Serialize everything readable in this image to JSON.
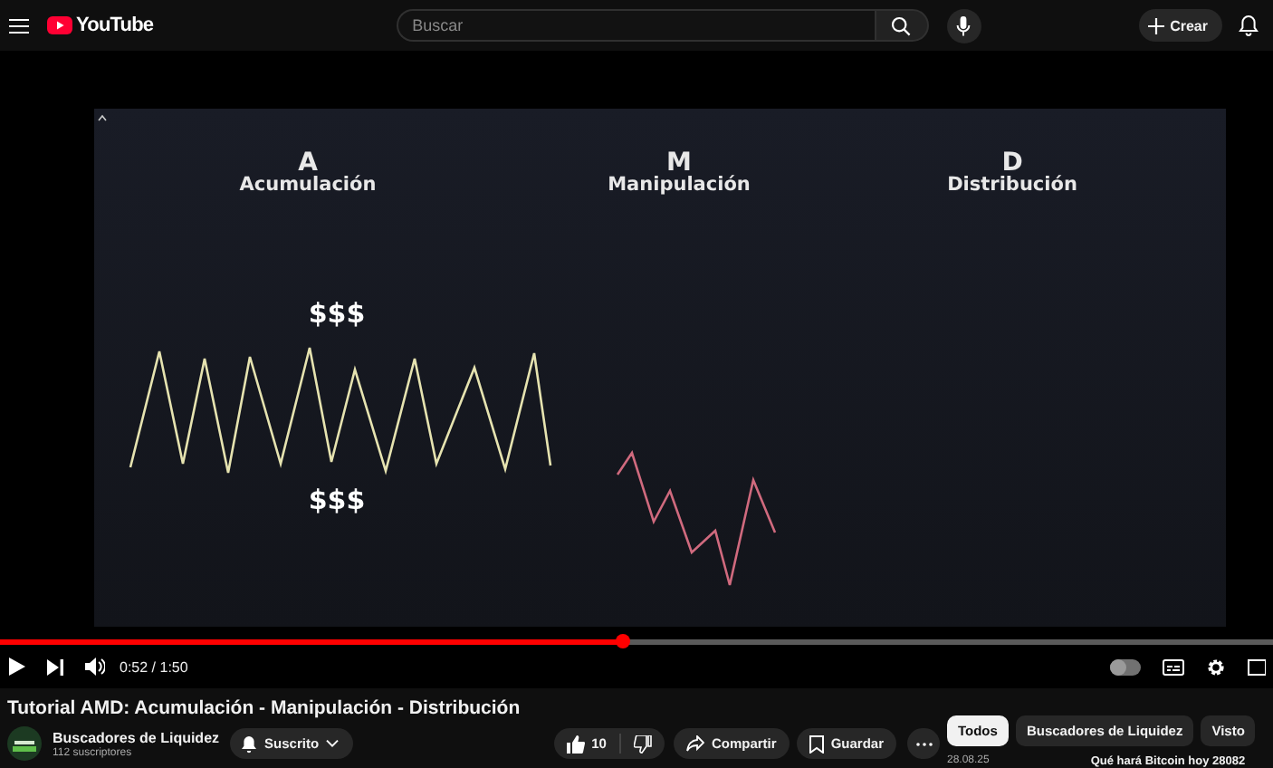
{
  "topbar": {
    "logo": "YouTube",
    "search": {
      "placeholder": "Buscar"
    },
    "create_button": "Crear"
  },
  "video": {
    "slide": {
      "columns": [
        {
          "letter": "A",
          "label": "Acumulación"
        },
        {
          "letter": "M",
          "label": "Manipulación"
        },
        {
          "letter": "D",
          "label": "Distribución"
        }
      ],
      "price_labels": [
        "$$$",
        "$$$"
      ]
    },
    "progress": {
      "level": 0.49
    },
    "time": "0:52 / 1:50",
    "autoplay": {
      "on": false
    }
  },
  "title": "Tutorial AMD: Acumulación - Manipulación - Distribución",
  "channel": {
    "name": "Buscadores de Liquidez",
    "subscribers": "112 suscriptores",
    "subscribe_button": "Suscrito"
  },
  "actions": {
    "likes": "10",
    "share": "Compartir",
    "save": "Guardar"
  },
  "chips": [
    {
      "label": "Todos",
      "selected": true
    },
    {
      "label": "Buscadores de Liquidez",
      "selected": false
    },
    {
      "label": "Visto",
      "selected": false
    }
  ],
  "recommended": {
    "date": "28.08.25",
    "title": "Qué hará Bitcoin hoy 28082"
  }
}
